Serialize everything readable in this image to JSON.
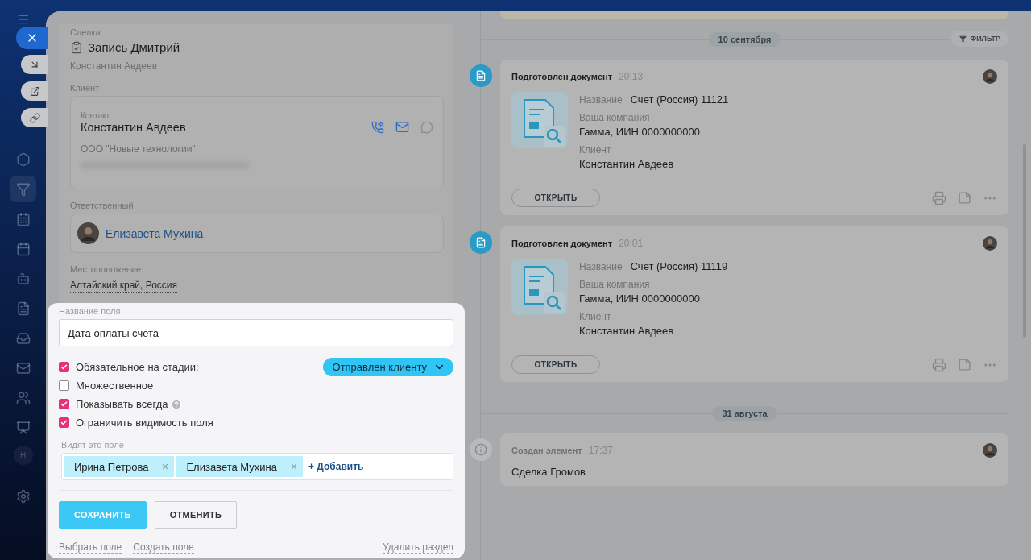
{
  "sidebar": {
    "avatar_letter": "Н"
  },
  "deal": {
    "label": "Сделка",
    "title": "Запись Дмитрий",
    "subtitle": "Константин Авдеев"
  },
  "client": {
    "label": "Клиент",
    "contact_label": "Контакт",
    "name": "Константин Авдеев",
    "company": "ООО \"Новые технологии\""
  },
  "responsible": {
    "label": "Ответственный",
    "name": "Елизавета Мухина"
  },
  "location": {
    "label": "Местоположение",
    "value": "Алтайский край, Россия"
  },
  "field_editor": {
    "name_label": "Название поля",
    "name_value": "Дата оплаты счета",
    "options": [
      {
        "kind": "stage",
        "label": "Обязательное на стадии:",
        "checked": true,
        "stage": "Отправлен клиенту"
      },
      {
        "kind": "plain",
        "label": "Множественное",
        "checked": false
      },
      {
        "kind": "help",
        "label": "Показывать всегда",
        "checked": true
      },
      {
        "kind": "plain",
        "label": "Ограничить видимость поля",
        "checked": true
      }
    ],
    "visible_label": "Видят это поле",
    "users": [
      "Ирина Петрова",
      "Елизавета Мухина"
    ],
    "add": "+ Добавить",
    "save": "СОХРАНИТЬ",
    "cancel": "ОТМЕНИТЬ",
    "links": [
      "Выбрать поле",
      "Создать поле"
    ],
    "delete": "Удалить раздел"
  },
  "timeline": {
    "filter": "ФИЛЬТР",
    "groups": [
      {
        "date": "10 сентября",
        "items": [
          {
            "kind": "document",
            "title": "Подготовлен документ",
            "time": "20:13",
            "fields": [
              {
                "label": "Название",
                "value": "Счет (Россия) 11121"
              },
              {
                "label": "Ваша компания",
                "value": "Гамма, ИИН 0000000000"
              },
              {
                "label": "Клиент",
                "value": "Константин Авдеев"
              }
            ],
            "button": "ОТКРЫТЬ"
          },
          {
            "kind": "document",
            "title": "Подготовлен документ",
            "time": "20:01",
            "fields": [
              {
                "label": "Название",
                "value": "Счет (Россия) 11119"
              },
              {
                "label": "Ваша компания",
                "value": "Гамма, ИИН 0000000000"
              },
              {
                "label": "Клиент",
                "value": "Константин Авдеев"
              }
            ],
            "button": "ОТКРЫТЬ"
          }
        ]
      },
      {
        "date": "31 августа",
        "items": [
          {
            "kind": "created",
            "title": "Создан элемент",
            "time": "17:37",
            "text": "Сделка Громов"
          }
        ]
      }
    ]
  }
}
